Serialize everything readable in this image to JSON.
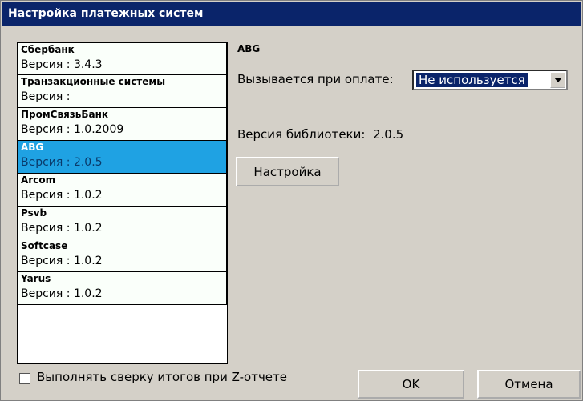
{
  "window": {
    "title": "Настройка платежных систем"
  },
  "systems": [
    {
      "name": "Сбербанк",
      "version": "Версия : 3.4.3",
      "selected": false
    },
    {
      "name": "Транзакционные системы",
      "version": "Версия :",
      "selected": false
    },
    {
      "name": "ПромСвязьБанк",
      "version": "Версия : 1.0.2009",
      "selected": false
    },
    {
      "name": "ABG",
      "version": "Версия : 2.0.5",
      "selected": true
    },
    {
      "name": "Arcom",
      "version": "Версия : 1.0.2",
      "selected": false
    },
    {
      "name": "Psvb",
      "version": "Версия : 1.0.2",
      "selected": false
    },
    {
      "name": "Softcase",
      "version": "Версия : 1.0.2",
      "selected": false
    },
    {
      "name": "Yarus",
      "version": "Версия : 1.0.2",
      "selected": false
    }
  ],
  "detail": {
    "name": "ABG",
    "invoked_label": "Вызывается при оплате:",
    "invoked_value": "Не используется",
    "library_label": "Версия библиотеки:",
    "library_version": "2.0.5",
    "settings_button": "Настройка"
  },
  "footer": {
    "reconcile_label": "Выполнять сверку итогов при Z-отчете",
    "reconcile_checked": false,
    "ok_button": "OK",
    "cancel_button": "Отмена"
  },
  "colors": {
    "title_bg": "#0a246a",
    "selected_bg": "#1fa2e3",
    "dialog_bg": "#d4d0c8"
  }
}
